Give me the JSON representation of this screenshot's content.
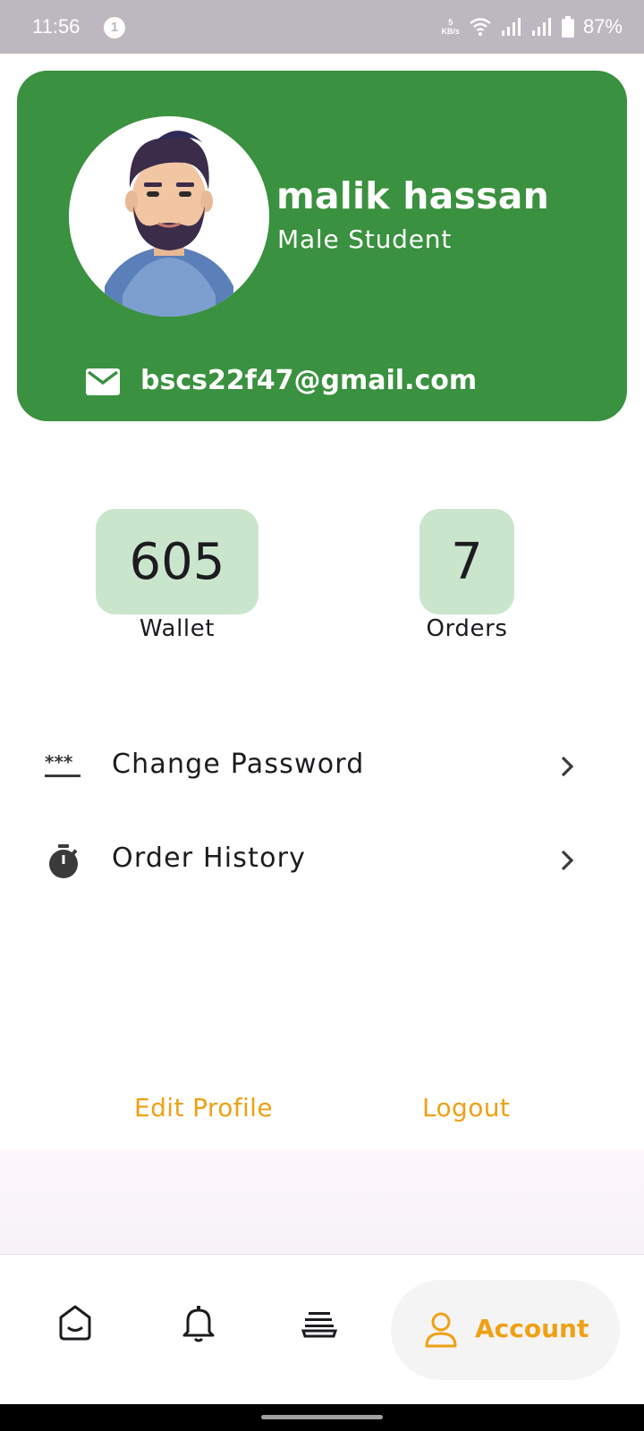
{
  "status_bar": {
    "time": "11:56",
    "notification_count": "1",
    "speed_value": "5",
    "speed_unit": "KB/s",
    "battery": "87%"
  },
  "profile": {
    "name": "malik hassan",
    "role": "Male Student",
    "email": "bscs22f47@gmail.com",
    "avatar_icon": "bearded-man-avatar",
    "card_color": "#3a913f"
  },
  "stats": {
    "wallet_value": "605",
    "wallet_label": "Wallet",
    "orders_value": "7",
    "orders_label": "Orders",
    "box_color": "#c9e6cc"
  },
  "menu": {
    "items": [
      {
        "label": "Change Password",
        "icon": "password-icon"
      },
      {
        "label": "Order History",
        "icon": "timer-icon"
      }
    ]
  },
  "actions": {
    "edit_profile": "Edit Profile",
    "logout": "Logout",
    "accent_color": "#f0a014"
  },
  "bottom_nav": {
    "items": [
      "home-icon",
      "bell-icon",
      "orders-icon",
      "account-icon"
    ],
    "active_label": "Account"
  }
}
